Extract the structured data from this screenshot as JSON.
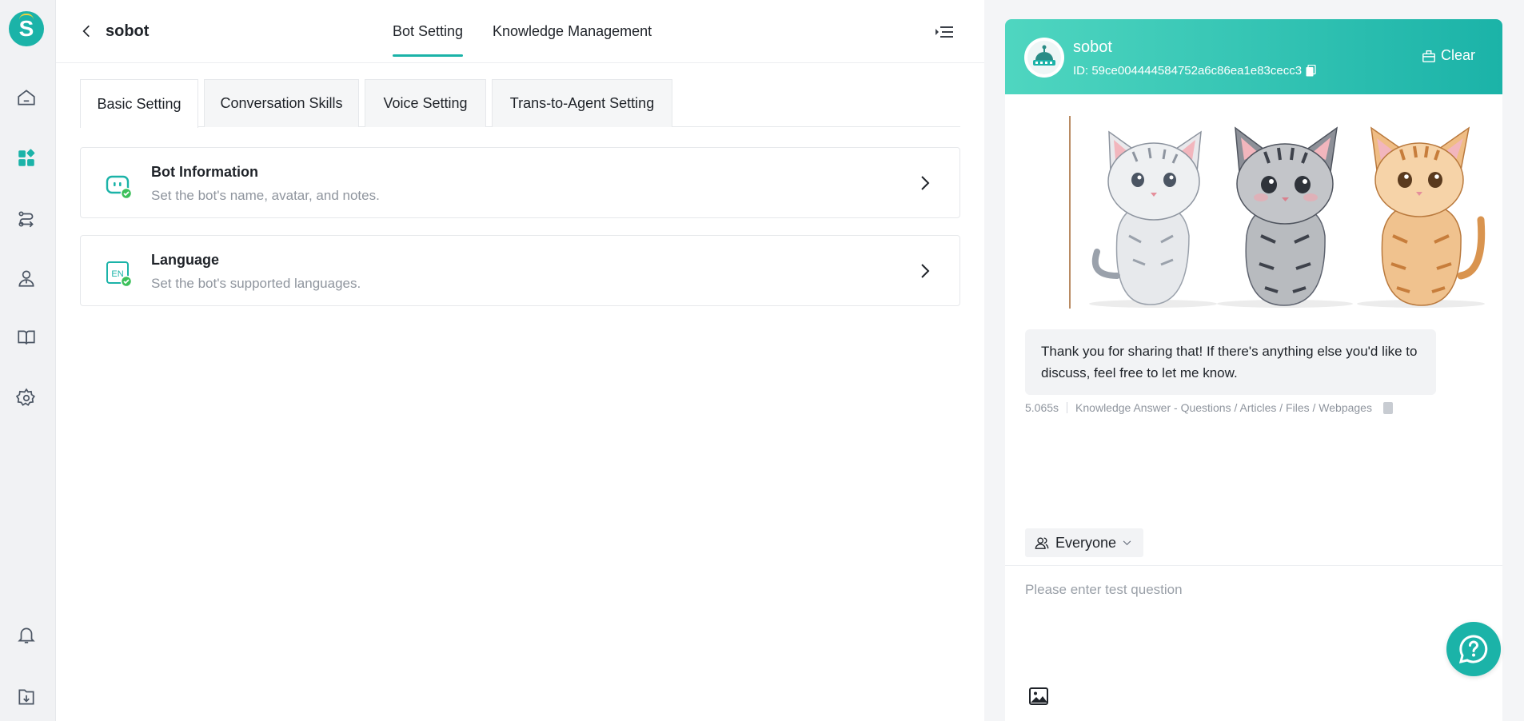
{
  "app": {
    "accent_color": "#1bb3a8",
    "logo_letter": "S"
  },
  "rail": {
    "items": [
      {
        "name": "home-icon"
      },
      {
        "name": "apps-icon",
        "active": true
      },
      {
        "name": "routing-icon"
      },
      {
        "name": "agent-icon"
      },
      {
        "name": "book-icon"
      },
      {
        "name": "gear-icon"
      },
      {
        "name": "bell-icon"
      },
      {
        "name": "download-icon"
      }
    ]
  },
  "header": {
    "bot_name": "sobot",
    "tabs": [
      {
        "label": "Bot Setting",
        "active": true
      },
      {
        "label": "Knowledge Management",
        "active": false
      }
    ]
  },
  "subtabs": [
    {
      "label": "Basic Setting",
      "active": true
    },
    {
      "label": "Conversation Skills",
      "active": false
    },
    {
      "label": "Voice Setting",
      "active": false
    },
    {
      "label": "Trans-to-Agent Setting",
      "active": false
    }
  ],
  "cards": [
    {
      "title": "Bot Information",
      "description": "Set the bot's name, avatar, and notes.",
      "icon": "bot-icon",
      "status": "configured"
    },
    {
      "title": "Language",
      "description": "Set the bot's supported languages.",
      "icon": "language-icon",
      "icon_text": "EN",
      "status": "configured"
    }
  ],
  "chat": {
    "bot_name": "sobot",
    "bot_id": "ID: 59ce004444584752a6c86ea1e83cecc3",
    "clear_label": "Clear",
    "image_alt": "three kittens illustration",
    "message": "Thank you for sharing that! If there's anything else you'd like to discuss, feel free to let me know.",
    "meta": {
      "response_time": "5.065s",
      "source": "Knowledge Answer - Questions / Articles / Files / Webpages"
    },
    "audience": "Everyone",
    "input_placeholder": "Please enter test question"
  }
}
